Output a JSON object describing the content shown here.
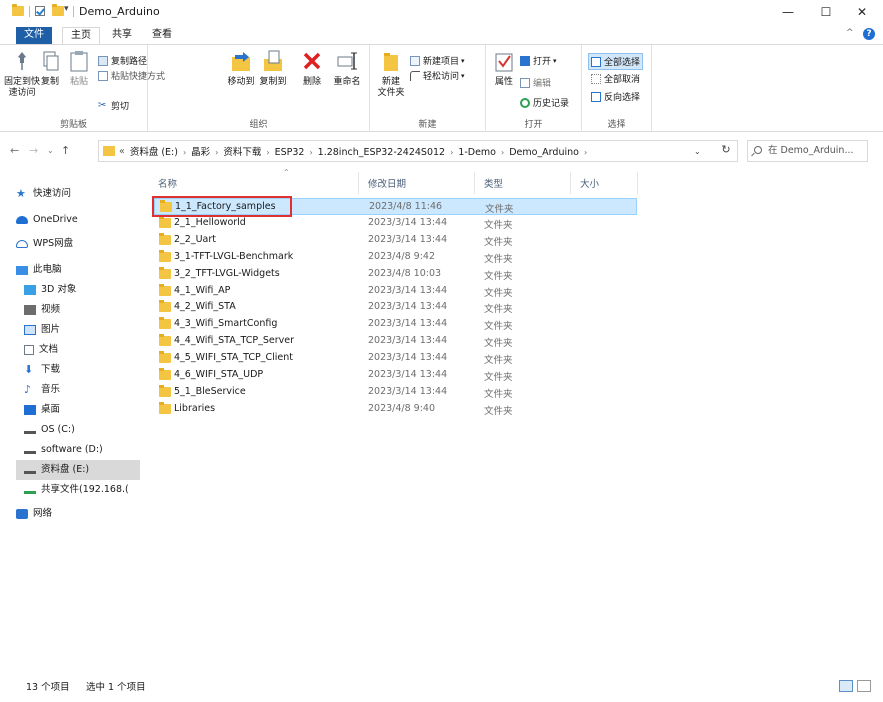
{
  "window": {
    "title": "Demo_Arduino",
    "minimize": "—",
    "maximize": "☐",
    "close": "✕"
  },
  "tabs": {
    "file": "文件",
    "home": "主页",
    "share": "共享",
    "view": "查看",
    "collapse": "^",
    "help": "?"
  },
  "ribbon": {
    "clipboard": {
      "label": "剪贴板",
      "pin": "固定到快\n速访问",
      "copy": "复制",
      "paste": "粘贴",
      "copy_path": "复制路径",
      "paste_shortcut": "粘贴快捷方式",
      "cut": "剪切"
    },
    "organize": {
      "label": "组织",
      "move_to": "移动到",
      "copy_to": "复制到",
      "delete": "删除",
      "rename": "重命名"
    },
    "new": {
      "label": "新建",
      "new_folder": "新建\n文件夹",
      "new_item": "新建项目",
      "easy_access": "轻松访问"
    },
    "open": {
      "label": "打开",
      "properties": "属性",
      "open": "打开",
      "edit": "编辑",
      "history": "历史记录"
    },
    "select": {
      "label": "选择",
      "select_all": "全部选择",
      "select_none": "全部取消",
      "invert": "反向选择"
    }
  },
  "address": {
    "prefix": "«",
    "crumbs": [
      "资料盘 (E:)",
      "晶彩",
      "资料下载",
      "ESP32",
      "1.28inch_ESP32-2424S012",
      "1-Demo",
      "Demo_Arduino"
    ],
    "search_placeholder": "在 Demo_Arduin..."
  },
  "navpane": [
    {
      "label": "快速访问",
      "icon": "star-icon"
    },
    {
      "label": "OneDrive",
      "icon": "cloud-icon"
    },
    {
      "label": "WPS网盘",
      "icon": "wps-cloud-icon"
    },
    {
      "label": "此电脑",
      "icon": "computer-icon"
    },
    {
      "label": "3D 对象",
      "icon": "cube-icon"
    },
    {
      "label": "视频",
      "icon": "video-icon"
    },
    {
      "label": "图片",
      "icon": "picture-icon"
    },
    {
      "label": "文档",
      "icon": "document-icon"
    },
    {
      "label": "下载",
      "icon": "download-icon"
    },
    {
      "label": "音乐",
      "icon": "music-icon"
    },
    {
      "label": "桌面",
      "icon": "desktop-icon"
    },
    {
      "label": "OS (C:)",
      "icon": "drive-icon"
    },
    {
      "label": "software (D:)",
      "icon": "drive-icon"
    },
    {
      "label": "资料盘 (E:)",
      "icon": "drive-icon"
    },
    {
      "label": "共享文件(192.168.(",
      "icon": "network-drive-icon"
    },
    {
      "label": "网络",
      "icon": "network-icon"
    }
  ],
  "columns": {
    "name": "名称",
    "date": "修改日期",
    "type": "类型",
    "size": "大小"
  },
  "files": [
    {
      "name": "1_1_Factory_samples",
      "date": "2023/4/8 11:46",
      "type": "文件夹"
    },
    {
      "name": "2_1_Helloworld",
      "date": "2023/3/14 13:44",
      "type": "文件夹"
    },
    {
      "name": "2_2_Uart",
      "date": "2023/3/14 13:44",
      "type": "文件夹"
    },
    {
      "name": "3_1-TFT-LVGL-Benchmark",
      "date": "2023/4/8 9:42",
      "type": "文件夹"
    },
    {
      "name": "3_2_TFT-LVGL-Widgets",
      "date": "2023/4/8 10:03",
      "type": "文件夹"
    },
    {
      "name": "4_1_Wifi_AP",
      "date": "2023/3/14 13:44",
      "type": "文件夹"
    },
    {
      "name": "4_2_Wifi_STA",
      "date": "2023/3/14 13:44",
      "type": "文件夹"
    },
    {
      "name": "4_3_Wifi_SmartConfig",
      "date": "2023/3/14 13:44",
      "type": "文件夹"
    },
    {
      "name": "4_4_Wifi_STA_TCP_Server",
      "date": "2023/3/14 13:44",
      "type": "文件夹"
    },
    {
      "name": "4_5_WIFI_STA_TCP_Client",
      "date": "2023/3/14 13:44",
      "type": "文件夹"
    },
    {
      "name": "4_6_WIFI_STA_UDP",
      "date": "2023/3/14 13:44",
      "type": "文件夹"
    },
    {
      "name": "5_1_BleService",
      "date": "2023/3/14 13:44",
      "type": "文件夹"
    },
    {
      "name": "Libraries",
      "date": "2023/4/8 9:40",
      "type": "文件夹"
    }
  ],
  "status": {
    "count": "13 个项目",
    "selected": "选中 1 个项目"
  },
  "colors": {
    "accent": "#1e5fa8",
    "selection": "#cce8ff",
    "highlight_box": "#e03131",
    "folder": "#f4c542"
  }
}
